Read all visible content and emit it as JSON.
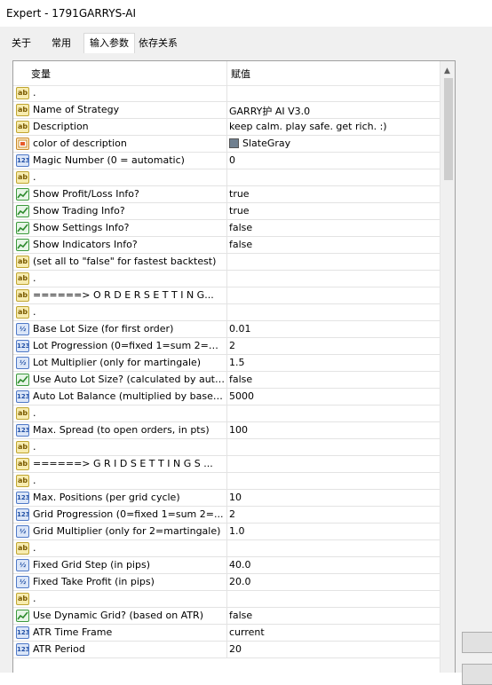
{
  "window": {
    "title": "Expert - 1791GARRYS-AI"
  },
  "tabs": [
    {
      "label": "关于"
    },
    {
      "label": "常用"
    },
    {
      "label": "输入参数"
    },
    {
      "label": "依存关系"
    }
  ],
  "grid": {
    "col_variable": "变量",
    "col_value": "赋值",
    "rows": [
      {
        "icon": "string",
        "name": ".",
        "value": ""
      },
      {
        "icon": "string",
        "name": "Name of Strategy",
        "value": "GARRY护 AI V3.0"
      },
      {
        "icon": "string",
        "name": "Description",
        "value": "keep calm. play safe. get rich. :)"
      },
      {
        "icon": "color",
        "name": "color of description",
        "value": "SlateGray"
      },
      {
        "icon": "int",
        "name": "Magic Number (0 = automatic)",
        "value": "0"
      },
      {
        "icon": "string",
        "name": ".",
        "value": ""
      },
      {
        "icon": "bool",
        "name": "Show Profit/Loss Info?",
        "value": "true"
      },
      {
        "icon": "bool",
        "name": "Show Trading Info?",
        "value": "true"
      },
      {
        "icon": "bool",
        "name": "Show Settings Info?",
        "value": "false"
      },
      {
        "icon": "bool",
        "name": "Show Indicators Info?",
        "value": "false"
      },
      {
        "icon": "string",
        "name": "(set all to \"false\" for fastest backtest)",
        "value": ""
      },
      {
        "icon": "string",
        "name": ".",
        "value": ""
      },
      {
        "icon": "string",
        "name": "======> O R D E R   S E T T I N G...",
        "value": ""
      },
      {
        "icon": "string",
        "name": ".",
        "value": ""
      },
      {
        "icon": "double",
        "name": "Base Lot Size (for first order)",
        "value": "0.01"
      },
      {
        "icon": "int",
        "name": "Lot Progression (0=fixed 1=sum 2=m...",
        "value": "2"
      },
      {
        "icon": "double",
        "name": "Lot Multiplier (only for martingale)",
        "value": "1.5"
      },
      {
        "icon": "bool",
        "name": "Use Auto Lot Size? (calculated by auto...",
        "value": "false"
      },
      {
        "icon": "int",
        "name": "Auto Lot Balance (multiplied by base l...",
        "value": "5000"
      },
      {
        "icon": "string",
        "name": ".",
        "value": ""
      },
      {
        "icon": "int",
        "name": "Max. Spread (to open orders, in pts)",
        "value": "100"
      },
      {
        "icon": "string",
        "name": ".",
        "value": ""
      },
      {
        "icon": "string",
        "name": "======> G R I D   S E T T I N G S ...",
        "value": ""
      },
      {
        "icon": "string",
        "name": ".",
        "value": ""
      },
      {
        "icon": "int",
        "name": "Max. Positions (per grid cycle)",
        "value": "10"
      },
      {
        "icon": "int",
        "name": "Grid Progression (0=fixed 1=sum 2=...",
        "value": "2"
      },
      {
        "icon": "double",
        "name": "Grid Multiplier (only for 2=martingale)",
        "value": "1.0"
      },
      {
        "icon": "string",
        "name": ".",
        "value": ""
      },
      {
        "icon": "double",
        "name": "Fixed Grid Step (in pips)",
        "value": "40.0"
      },
      {
        "icon": "double",
        "name": "Fixed Take Profit (in pips)",
        "value": "20.0"
      },
      {
        "icon": "string",
        "name": ".",
        "value": ""
      },
      {
        "icon": "bool",
        "name": "Use Dynamic Grid? (based on ATR)",
        "value": "false"
      },
      {
        "icon": "int",
        "name": "ATR Time Frame",
        "value": "current"
      },
      {
        "icon": "int",
        "name": "ATR Period",
        "value": "20"
      }
    ]
  },
  "colors": {
    "slate_gray": "#708090",
    "tab_bg": "#f0f0f0",
    "grid_border": "#a0a0a0"
  }
}
